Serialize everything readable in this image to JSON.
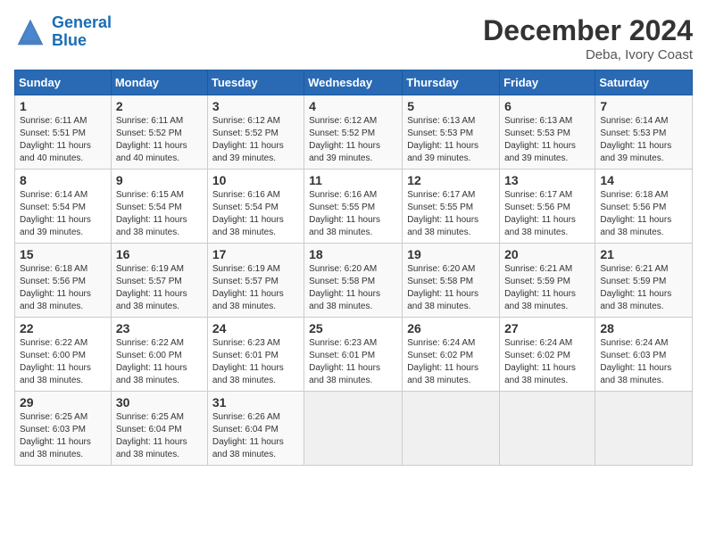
{
  "logo": {
    "line1": "General",
    "line2": "Blue"
  },
  "title": "December 2024",
  "subtitle": "Deba, Ivory Coast",
  "days_of_week": [
    "Sunday",
    "Monday",
    "Tuesday",
    "Wednesday",
    "Thursday",
    "Friday",
    "Saturday"
  ],
  "weeks": [
    [
      {
        "day": "1",
        "sunrise": "6:11 AM",
        "sunset": "5:51 PM",
        "daylight": "11 hours and 40 minutes."
      },
      {
        "day": "2",
        "sunrise": "6:11 AM",
        "sunset": "5:52 PM",
        "daylight": "11 hours and 40 minutes."
      },
      {
        "day": "3",
        "sunrise": "6:12 AM",
        "sunset": "5:52 PM",
        "daylight": "11 hours and 39 minutes."
      },
      {
        "day": "4",
        "sunrise": "6:12 AM",
        "sunset": "5:52 PM",
        "daylight": "11 hours and 39 minutes."
      },
      {
        "day": "5",
        "sunrise": "6:13 AM",
        "sunset": "5:53 PM",
        "daylight": "11 hours and 39 minutes."
      },
      {
        "day": "6",
        "sunrise": "6:13 AM",
        "sunset": "5:53 PM",
        "daylight": "11 hours and 39 minutes."
      },
      {
        "day": "7",
        "sunrise": "6:14 AM",
        "sunset": "5:53 PM",
        "daylight": "11 hours and 39 minutes."
      }
    ],
    [
      {
        "day": "8",
        "sunrise": "6:14 AM",
        "sunset": "5:54 PM",
        "daylight": "11 hours and 39 minutes."
      },
      {
        "day": "9",
        "sunrise": "6:15 AM",
        "sunset": "5:54 PM",
        "daylight": "11 hours and 38 minutes."
      },
      {
        "day": "10",
        "sunrise": "6:16 AM",
        "sunset": "5:54 PM",
        "daylight": "11 hours and 38 minutes."
      },
      {
        "day": "11",
        "sunrise": "6:16 AM",
        "sunset": "5:55 PM",
        "daylight": "11 hours and 38 minutes."
      },
      {
        "day": "12",
        "sunrise": "6:17 AM",
        "sunset": "5:55 PM",
        "daylight": "11 hours and 38 minutes."
      },
      {
        "day": "13",
        "sunrise": "6:17 AM",
        "sunset": "5:56 PM",
        "daylight": "11 hours and 38 minutes."
      },
      {
        "day": "14",
        "sunrise": "6:18 AM",
        "sunset": "5:56 PM",
        "daylight": "11 hours and 38 minutes."
      }
    ],
    [
      {
        "day": "15",
        "sunrise": "6:18 AM",
        "sunset": "5:56 PM",
        "daylight": "11 hours and 38 minutes."
      },
      {
        "day": "16",
        "sunrise": "6:19 AM",
        "sunset": "5:57 PM",
        "daylight": "11 hours and 38 minutes."
      },
      {
        "day": "17",
        "sunrise": "6:19 AM",
        "sunset": "5:57 PM",
        "daylight": "11 hours and 38 minutes."
      },
      {
        "day": "18",
        "sunrise": "6:20 AM",
        "sunset": "5:58 PM",
        "daylight": "11 hours and 38 minutes."
      },
      {
        "day": "19",
        "sunrise": "6:20 AM",
        "sunset": "5:58 PM",
        "daylight": "11 hours and 38 minutes."
      },
      {
        "day": "20",
        "sunrise": "6:21 AM",
        "sunset": "5:59 PM",
        "daylight": "11 hours and 38 minutes."
      },
      {
        "day": "21",
        "sunrise": "6:21 AM",
        "sunset": "5:59 PM",
        "daylight": "11 hours and 38 minutes."
      }
    ],
    [
      {
        "day": "22",
        "sunrise": "6:22 AM",
        "sunset": "6:00 PM",
        "daylight": "11 hours and 38 minutes."
      },
      {
        "day": "23",
        "sunrise": "6:22 AM",
        "sunset": "6:00 PM",
        "daylight": "11 hours and 38 minutes."
      },
      {
        "day": "24",
        "sunrise": "6:23 AM",
        "sunset": "6:01 PM",
        "daylight": "11 hours and 38 minutes."
      },
      {
        "day": "25",
        "sunrise": "6:23 AM",
        "sunset": "6:01 PM",
        "daylight": "11 hours and 38 minutes."
      },
      {
        "day": "26",
        "sunrise": "6:24 AM",
        "sunset": "6:02 PM",
        "daylight": "11 hours and 38 minutes."
      },
      {
        "day": "27",
        "sunrise": "6:24 AM",
        "sunset": "6:02 PM",
        "daylight": "11 hours and 38 minutes."
      },
      {
        "day": "28",
        "sunrise": "6:24 AM",
        "sunset": "6:03 PM",
        "daylight": "11 hours and 38 minutes."
      }
    ],
    [
      {
        "day": "29",
        "sunrise": "6:25 AM",
        "sunset": "6:03 PM",
        "daylight": "11 hours and 38 minutes."
      },
      {
        "day": "30",
        "sunrise": "6:25 AM",
        "sunset": "6:04 PM",
        "daylight": "11 hours and 38 minutes."
      },
      {
        "day": "31",
        "sunrise": "6:26 AM",
        "sunset": "6:04 PM",
        "daylight": "11 hours and 38 minutes."
      },
      null,
      null,
      null,
      null
    ]
  ]
}
